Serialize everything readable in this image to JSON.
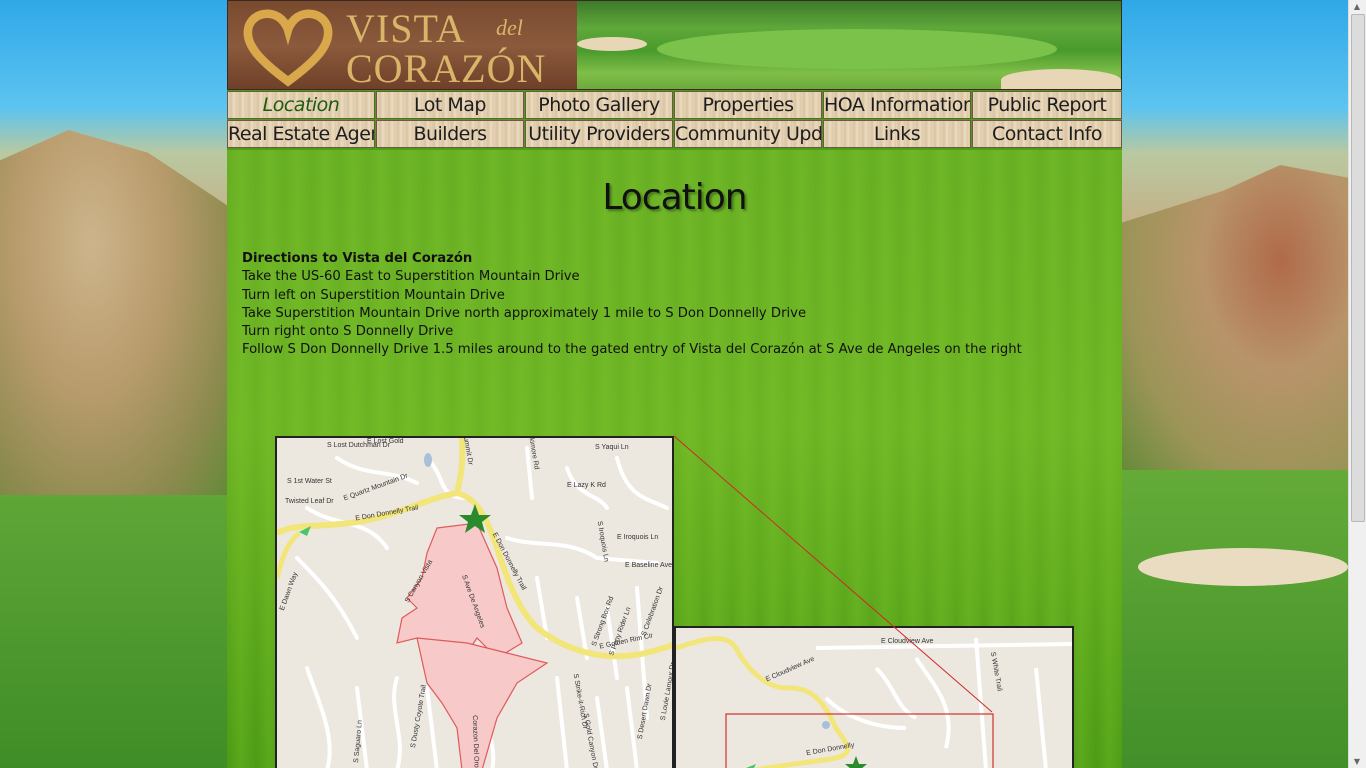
{
  "site": {
    "logo": {
      "line1": "VISTA",
      "line2": "del",
      "line3": "CORAZÓN"
    }
  },
  "nav": {
    "row1": [
      "Location",
      "Lot Map",
      "Photo Gallery",
      "Properties",
      "HOA Information",
      "Public Report"
    ],
    "row2": [
      "Real Estate Agents",
      "Builders",
      "Utility Providers",
      "Community Updates",
      "Links",
      "Contact Info"
    ],
    "active": "Location"
  },
  "main": {
    "title": "Location",
    "directions_heading": "Directions to Vista del Corazón",
    "directions": [
      "Take the US-60 East to Superstition Mountain Drive",
      "Turn left on Superstition Mountain Drive",
      "Take Superstition Mountain Drive north approximately 1 mile to S Don Donnelly Drive",
      "Turn right onto S Donnelly Drive",
      "Follow S Don Donnelly Drive 1.5 miles around to the gated entry of Vista del Corazón at S Ave de Angeles on the right"
    ]
  },
  "map_detail": {
    "labels": [
      "E Don Donnelly Trail",
      "E Don Donnelly Trail",
      "E Golden Rim Cir",
      "E Baseline Ave",
      "S Yaqui Ln",
      "E Lazy K Rd",
      "S Iroquois Ln",
      "E Iroquois Ln",
      "S 1st Water St",
      "E Quartz Mountain Dr",
      "Twisted Leaf Dr",
      "S Ave De Angeles",
      "S Canyon Vista",
      "S Strong Box Rd",
      "S Pony Rider Ln",
      "S Celebration Dr",
      "S Desert Dawn Dr",
      "S Louie Lamour Dr",
      "S Strike-it-Rich Dr",
      "S Gold Canyon Dr",
      "S Dusty Coyote Trail",
      "S Saguaro Ln",
      "Corazon Del Oro",
      "E Dawn Way",
      "S Lost Dutchman Dr",
      "E Lost Gold",
      "S Summit Dr",
      "Skimore Rd"
    ]
  },
  "map_overview": {
    "labels": [
      "E Cloudview Ave",
      "E Cloudview Ave",
      "S White Trail",
      "E Don Donnelly"
    ]
  }
}
